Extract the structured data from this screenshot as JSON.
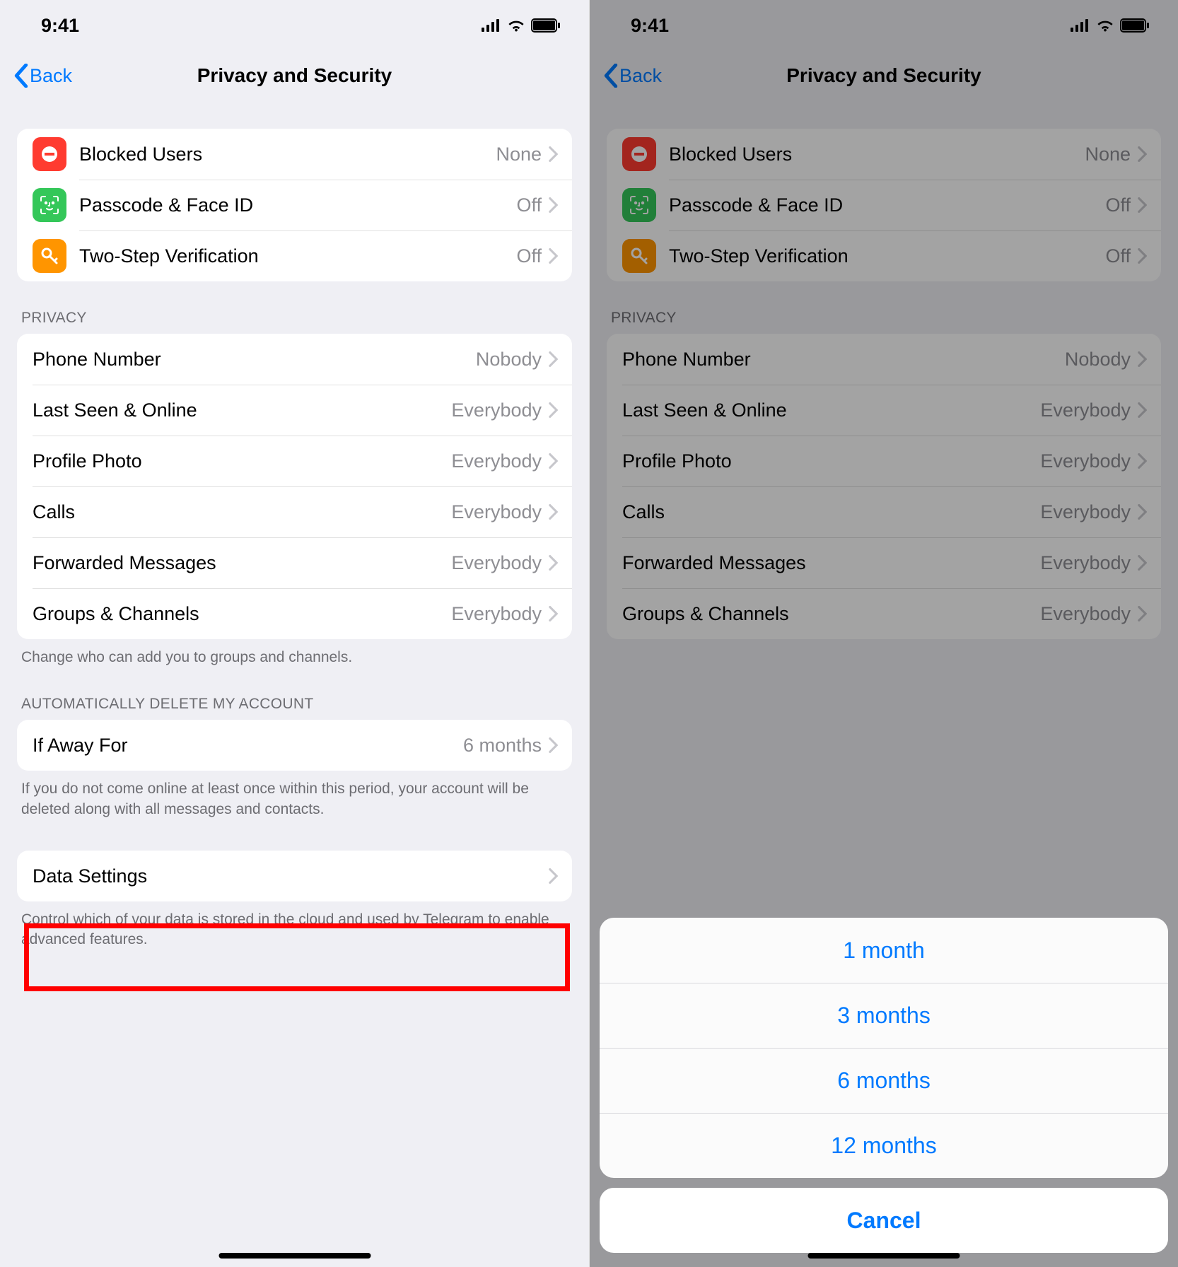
{
  "status": {
    "time": "9:41"
  },
  "nav": {
    "back": "Back",
    "title": "Privacy and Security"
  },
  "group1": [
    {
      "label": "Blocked Users",
      "value": "None",
      "icon": "blocked"
    },
    {
      "label": "Passcode & Face ID",
      "value": "Off",
      "icon": "passcode"
    },
    {
      "label": "Two-Step Verification",
      "value": "Off",
      "icon": "key"
    }
  ],
  "privacy": {
    "header": "PRIVACY",
    "rows": [
      {
        "label": "Phone Number",
        "value": "Nobody"
      },
      {
        "label": "Last Seen & Online",
        "value": "Everybody"
      },
      {
        "label": "Profile Photo",
        "value": "Everybody"
      },
      {
        "label": "Calls",
        "value": "Everybody"
      },
      {
        "label": "Forwarded Messages",
        "value": "Everybody"
      },
      {
        "label": "Groups & Channels",
        "value": "Everybody"
      }
    ],
    "footer": "Change who can add you to groups and channels."
  },
  "auto_delete": {
    "header": "AUTOMATICALLY DELETE MY ACCOUNT",
    "label": "If Away For",
    "value": "6 months",
    "footer": "If you do not come online at least once within this period, your account will be deleted along with all messages and contacts."
  },
  "data_settings": {
    "label": "Data Settings",
    "footer": "Control which of your data is stored in the cloud and used by Telegram to enable advanced features."
  },
  "sheet": {
    "options": [
      "1 month",
      "3 months",
      "6 months",
      "12 months"
    ],
    "cancel": "Cancel"
  }
}
